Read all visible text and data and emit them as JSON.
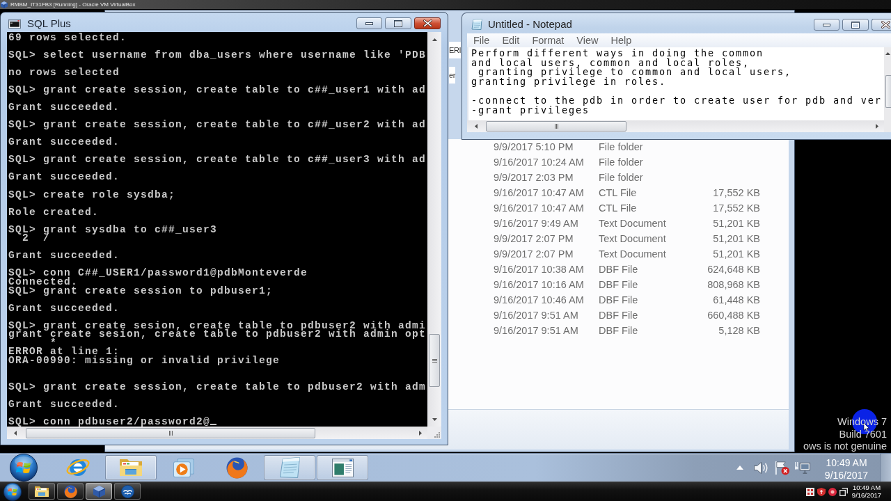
{
  "host_window": {
    "title": "RMBM_IT31FB3 [Running] - Oracle VM VirtualBox"
  },
  "explorer": {
    "header_labels": [
      "ERI",
      "er"
    ],
    "rows": [
      {
        "column_1": "9/9/2017 5:10 PM",
        "column_2": "File folder"
      },
      {
        "column_1": "9/16/2017 10:24 AM",
        "column_2": "File folder"
      },
      {
        "column_1": "9/9/2017 2:03 PM",
        "column_2": "File folder"
      },
      {
        "column_1": "9/16/2017 10:47 AM",
        "column_2": "CTL File",
        "column_3": "17,552 KB"
      },
      {
        "column_1": "9/16/2017 10:47 AM",
        "column_2": "CTL File",
        "column_3": "17,552 KB"
      },
      {
        "column_1": "9/16/2017 9:49 AM",
        "column_2": "Text Document",
        "column_3": "51,201 KB"
      },
      {
        "column_1": "9/9/2017 2:07 PM",
        "column_2": "Text Document",
        "column_3": "51,201 KB"
      },
      {
        "column_1": "9/9/2017 2:07 PM",
        "column_2": "Text Document",
        "column_3": "51,201 KB"
      },
      {
        "column_1": "9/16/2017 10:38 AM",
        "column_2": "DBF File",
        "column_3": "624,648 KB"
      },
      {
        "column_1": "9/16/2017 10:16 AM",
        "column_2": "DBF File",
        "column_3": "808,968 KB"
      },
      {
        "column_1": "9/16/2017 10:46 AM",
        "column_2": "DBF File",
        "column_3": "61,448 KB"
      },
      {
        "column_1": "9/16/2017 9:51 AM",
        "column_2": "DBF File",
        "column_3": "660,488 KB"
      },
      {
        "column_1": "9/16/2017 9:51 AM",
        "column_2": "DBF File",
        "column_3": "5,128 KB"
      }
    ]
  },
  "sqlplus": {
    "title": "SQL Plus",
    "lines": [
      {
        "kind": "text",
        "text": "69 rows selected."
      },
      {
        "kind": "blank"
      },
      {
        "kind": "text",
        "text": "SQL> select username from dba_users where username like 'PDB"
      },
      {
        "kind": "blank"
      },
      {
        "kind": "text",
        "text": "no rows selected"
      },
      {
        "kind": "blank"
      },
      {
        "kind": "text",
        "text": "SQL> grant create session, create table to c##_user1 with ad"
      },
      {
        "kind": "blank"
      },
      {
        "kind": "text",
        "text": "Grant succeeded."
      },
      {
        "kind": "blank"
      },
      {
        "kind": "text",
        "text": "SQL> grant create session, create table to c##_user2 with ad"
      },
      {
        "kind": "blank"
      },
      {
        "kind": "text",
        "text": "Grant succeeded."
      },
      {
        "kind": "blank"
      },
      {
        "kind": "text",
        "text": "SQL> grant create session, create table to c##_user3 with ad"
      },
      {
        "kind": "blank"
      },
      {
        "kind": "text",
        "text": "Grant succeeded."
      },
      {
        "kind": "blank"
      },
      {
        "kind": "text",
        "text": "SQL> create role sysdba;"
      },
      {
        "kind": "blank"
      },
      {
        "kind": "text",
        "text": "Role created."
      },
      {
        "kind": "blank"
      },
      {
        "kind": "text",
        "text": "SQL> grant sysdba to c##_user3"
      },
      {
        "kind": "text",
        "text": "  2  /"
      },
      {
        "kind": "blank"
      },
      {
        "kind": "text",
        "text": "Grant succeeded."
      },
      {
        "kind": "blank"
      },
      {
        "kind": "text",
        "text": "SQL> conn C##_USER1/password1@pdbMonteverde"
      },
      {
        "kind": "text",
        "text": "Connected."
      },
      {
        "kind": "text",
        "text": "SQL> grant create session to pdbuser1;"
      },
      {
        "kind": "blank"
      },
      {
        "kind": "text",
        "text": "Grant succeeded."
      },
      {
        "kind": "blank"
      },
      {
        "kind": "text",
        "text": "SQL> grant create sesion, create table to pdbuser2 with admi"
      },
      {
        "kind": "text",
        "text": "grant create sesion, create table to pdbuser2 with admin opt"
      },
      {
        "kind": "text",
        "text": "      *"
      },
      {
        "kind": "text",
        "text": "ERROR at line 1:"
      },
      {
        "kind": "text",
        "text": "ORA-00990: missing or invalid privilege"
      },
      {
        "kind": "blank"
      },
      {
        "kind": "blank"
      },
      {
        "kind": "text",
        "text": "SQL> grant create session, create table to pdbuser2 with adm"
      },
      {
        "kind": "blank"
      },
      {
        "kind": "text",
        "text": "Grant succeeded."
      },
      {
        "kind": "blank"
      },
      {
        "kind": "text",
        "text": "SQL> conn pdbuser2/password2@"
      }
    ],
    "cursor": true
  },
  "notepad": {
    "title": "Untitled - Notepad",
    "menu": [
      "File",
      "Edit",
      "Format",
      "View",
      "Help"
    ],
    "paragraphs": [
      [
        "Perform different ways in doing the common",
        "and local users, common and local roles,",
        " granting privilege to common and local users,",
        "granting privilege in roles."
      ],
      [
        "-connect to the pdb in order to create user for pdb and ver",
        "-grant privileges"
      ]
    ]
  },
  "desktop": {
    "notice": [
      "Windows 7",
      "Build 7601",
      "ows is not genuine"
    ]
  },
  "guest_taskbar": {
    "apps": [
      {
        "kind": "e",
        "running": false
      },
      {
        "kind": "folder",
        "running": true
      },
      {
        "kind": "player",
        "running": false
      },
      {
        "kind": "globe",
        "running": false
      },
      {
        "kind": "notepad",
        "running": true
      },
      {
        "kind": "console",
        "running": true
      }
    ],
    "clock": {
      "time": "10:49 AM",
      "date": "9/16/2017"
    }
  },
  "host_taskbar": {
    "apps": [
      {
        "kind": "folder",
        "active": false
      },
      {
        "kind": "globe",
        "active": false
      },
      {
        "kind": "cube",
        "active": true
      },
      {
        "kind": "gulls",
        "active": false
      }
    ],
    "clock": {
      "time": "10:49 AM",
      "date": "9/16/2017"
    }
  }
}
